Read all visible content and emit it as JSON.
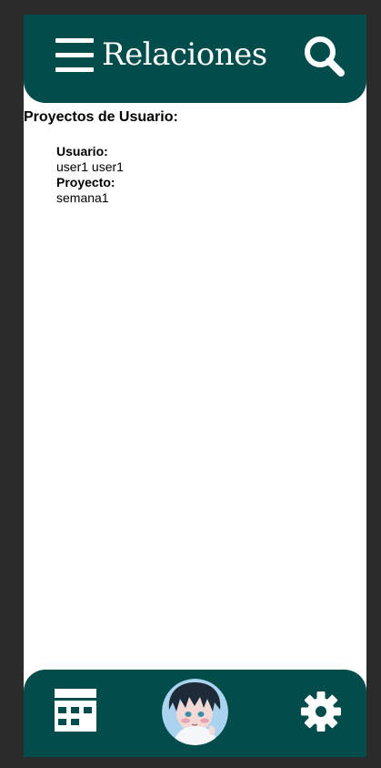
{
  "header": {
    "title": "Relaciones",
    "menu_icon": "hamburger-menu-icon",
    "search_icon": "search-icon"
  },
  "main": {
    "section_title": "Proyectos de Usuario:",
    "records": [
      {
        "user_label": "Usuario:",
        "user_value": "user1 user1",
        "project_label": "Proyecto:",
        "project_value": "semana1"
      }
    ]
  },
  "footer": {
    "calendar_icon": "calendar-icon",
    "avatar_icon": "user-avatar",
    "settings_icon": "gear-icon"
  },
  "colors": {
    "primary": "#024d4b",
    "background": "#ffffff",
    "outer": "#2b2b2b",
    "text": "#000000"
  }
}
